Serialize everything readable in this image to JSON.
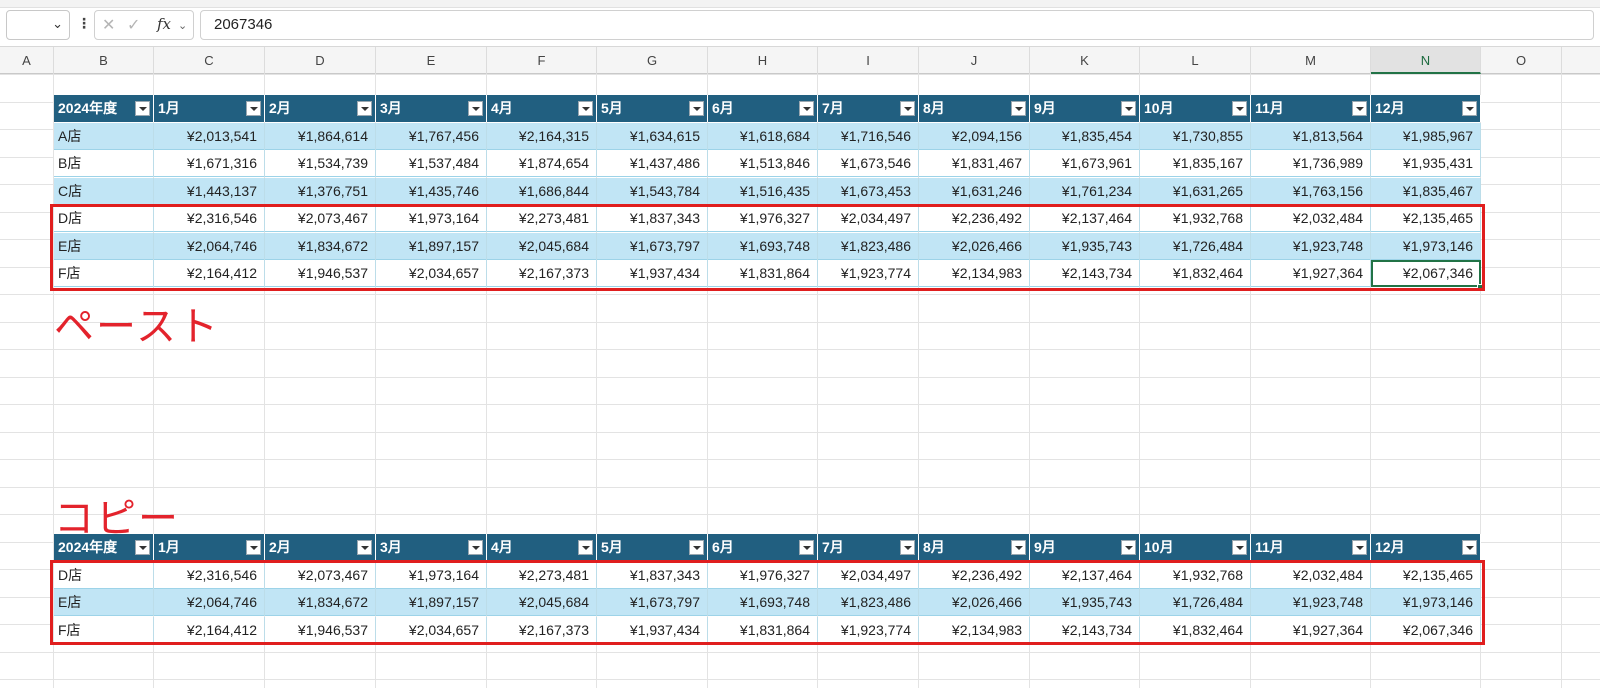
{
  "formula_bar": {
    "value": "2067346",
    "fx_label": "fx"
  },
  "columns": [
    "A",
    "B",
    "C",
    "D",
    "E",
    "F",
    "G",
    "H",
    "I",
    "J",
    "K",
    "L",
    "M",
    "N",
    "O"
  ],
  "active_column": "N",
  "top_table": {
    "headers": [
      "2024年度",
      "1月",
      "2月",
      "3月",
      "4月",
      "5月",
      "6月",
      "7月",
      "8月",
      "9月",
      "10月",
      "11月",
      "12月"
    ],
    "rows": [
      [
        "A店",
        "¥2,013,541",
        "¥1,864,614",
        "¥1,767,456",
        "¥2,164,315",
        "¥1,634,615",
        "¥1,618,684",
        "¥1,716,546",
        "¥2,094,156",
        "¥1,835,454",
        "¥1,730,855",
        "¥1,813,564",
        "¥1,985,967"
      ],
      [
        "B店",
        "¥1,671,316",
        "¥1,534,739",
        "¥1,537,484",
        "¥1,874,654",
        "¥1,437,486",
        "¥1,513,846",
        "¥1,673,546",
        "¥1,831,467",
        "¥1,673,961",
        "¥1,835,167",
        "¥1,736,989",
        "¥1,935,431"
      ],
      [
        "C店",
        "¥1,443,137",
        "¥1,376,751",
        "¥1,435,746",
        "¥1,686,844",
        "¥1,543,784",
        "¥1,516,435",
        "¥1,673,453",
        "¥1,631,246",
        "¥1,761,234",
        "¥1,631,265",
        "¥1,763,156",
        "¥1,835,467"
      ],
      [
        "D店",
        "¥2,316,546",
        "¥2,073,467",
        "¥1,973,164",
        "¥2,273,481",
        "¥1,837,343",
        "¥1,976,327",
        "¥2,034,497",
        "¥2,236,492",
        "¥2,137,464",
        "¥1,932,768",
        "¥2,032,484",
        "¥2,135,465"
      ],
      [
        "E店",
        "¥2,064,746",
        "¥1,834,672",
        "¥1,897,157",
        "¥2,045,684",
        "¥1,673,797",
        "¥1,693,748",
        "¥1,823,486",
        "¥2,026,466",
        "¥1,935,743",
        "¥1,726,484",
        "¥1,923,748",
        "¥1,973,146"
      ],
      [
        "F店",
        "¥2,164,412",
        "¥1,946,537",
        "¥2,034,657",
        "¥2,167,373",
        "¥1,937,434",
        "¥1,831,864",
        "¥1,923,774",
        "¥2,134,983",
        "¥2,143,734",
        "¥1,832,464",
        "¥1,927,364",
        "¥2,067,346"
      ]
    ]
  },
  "bottom_table": {
    "headers": [
      "2024年度",
      "1月",
      "2月",
      "3月",
      "4月",
      "5月",
      "6月",
      "7月",
      "8月",
      "9月",
      "10月",
      "11月",
      "12月"
    ],
    "rows": [
      [
        "D店",
        "¥2,316,546",
        "¥2,073,467",
        "¥1,973,164",
        "¥2,273,481",
        "¥1,837,343",
        "¥1,976,327",
        "¥2,034,497",
        "¥2,236,492",
        "¥2,137,464",
        "¥1,932,768",
        "¥2,032,484",
        "¥2,135,465"
      ],
      [
        "E店",
        "¥2,064,746",
        "¥1,834,672",
        "¥1,897,157",
        "¥2,045,684",
        "¥1,673,797",
        "¥1,693,748",
        "¥1,823,486",
        "¥2,026,466",
        "¥1,935,743",
        "¥1,726,484",
        "¥1,923,748",
        "¥1,973,146"
      ],
      [
        "F店",
        "¥2,164,412",
        "¥1,946,537",
        "¥2,034,657",
        "¥2,167,373",
        "¥1,937,434",
        "¥1,831,864",
        "¥1,923,774",
        "¥2,134,983",
        "¥2,143,734",
        "¥1,832,464",
        "¥1,927,364",
        "¥2,067,346"
      ]
    ]
  },
  "annotations": {
    "paste_label": "ペースト",
    "copy_label": "コピー"
  },
  "colors": {
    "header_bg": "#215f80",
    "band_bg": "#c1e5f5",
    "highlight": "#e01e1e",
    "accent": "#217346"
  }
}
